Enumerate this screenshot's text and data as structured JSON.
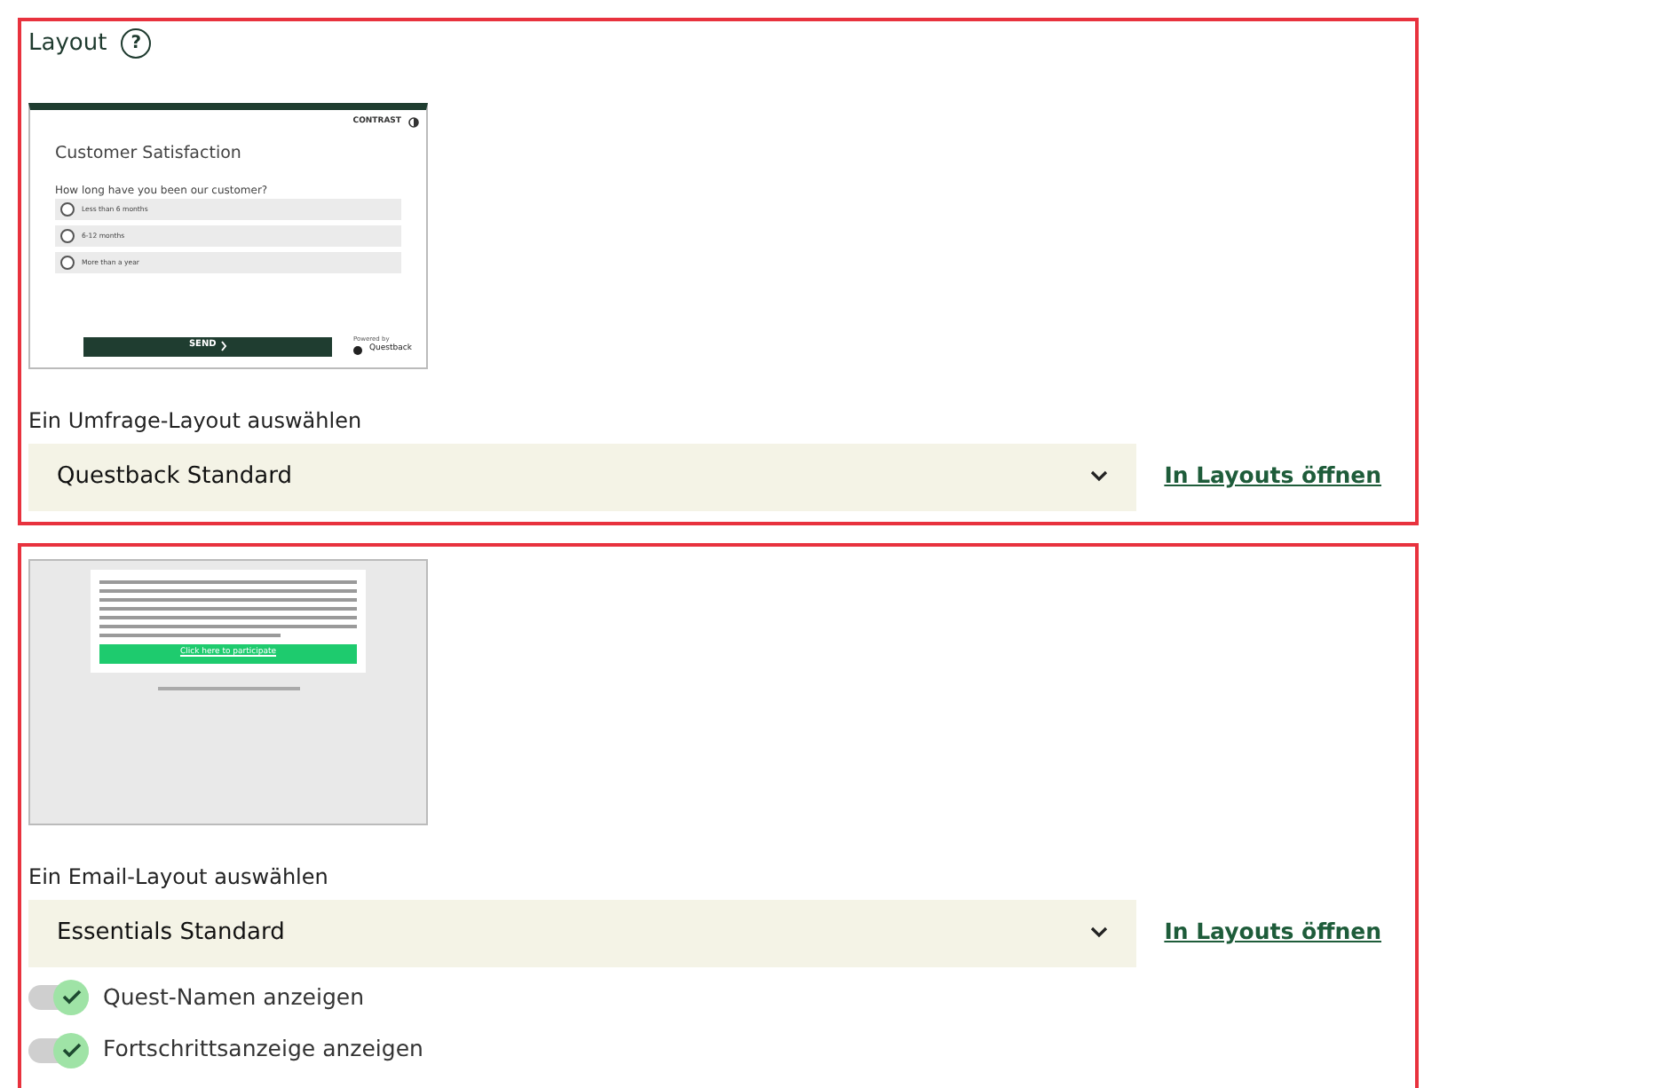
{
  "survey_section": {
    "title": "Layout",
    "help_icon": "?",
    "preview": {
      "contrast": "CONTRAST",
      "title": "Customer Satisfaction",
      "question": "How long have you been our customer?",
      "options": [
        {
          "label": "Less than 6 months",
          "selected": false
        },
        {
          "label": "6-12 months",
          "selected": false
        },
        {
          "label": "More than a year",
          "selected": false
        }
      ],
      "send": "SEND",
      "powered_by": "Powered by",
      "brand": "Questback"
    },
    "select_label": "Ein Umfrage-Layout auswählen",
    "select_value": "Questback Standard",
    "link": "In Layouts öffnen"
  },
  "email_section": {
    "preview": {
      "button": "Click here to participate"
    },
    "select_label": "Ein Email-Layout auswählen",
    "select_value": "Essentials Standard",
    "link": "In Layouts öffnen",
    "toggles": [
      {
        "label": "Quest-Namen anzeigen",
        "on": true
      },
      {
        "label": "Fortschrittsanzeige anzeigen",
        "on": true
      }
    ]
  }
}
